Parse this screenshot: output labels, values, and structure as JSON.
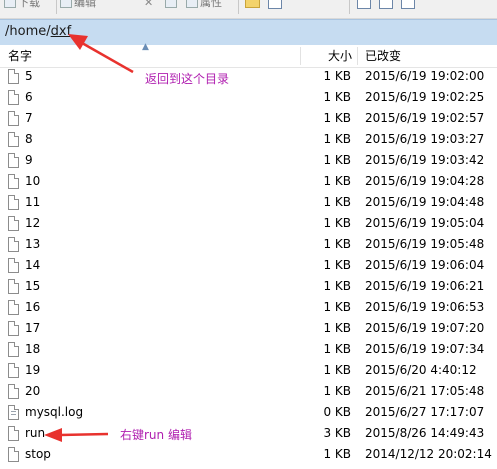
{
  "toolbar": {
    "items": [
      {
        "icon": "download-icon",
        "label": "下载"
      },
      {
        "icon": "edit-icon",
        "label": "编辑"
      },
      {
        "icon": "delete-icon",
        "label": ""
      },
      {
        "icon": "rename-icon",
        "label": ""
      },
      {
        "icon": "properties-icon",
        "label": "属性"
      },
      {
        "icon": "folder-icon",
        "label": ""
      },
      {
        "icon": "refresh-icon",
        "label": ""
      },
      {
        "icon": "upload-icon",
        "label": ""
      },
      {
        "icon": "window-icon",
        "label": ""
      },
      {
        "icon": "window-icon",
        "label": ""
      }
    ]
  },
  "path": {
    "prefix": "/home/",
    "current": "dxf"
  },
  "columns": {
    "name": "名字",
    "size": "大小",
    "modified": "已改变"
  },
  "files": [
    {
      "name": "5",
      "size": "1 KB",
      "modified": "2015/6/19 19:02:00",
      "icon": "file-icon"
    },
    {
      "name": "6",
      "size": "1 KB",
      "modified": "2015/6/19 19:02:25",
      "icon": "file-icon"
    },
    {
      "name": "7",
      "size": "1 KB",
      "modified": "2015/6/19 19:02:57",
      "icon": "file-icon"
    },
    {
      "name": "8",
      "size": "1 KB",
      "modified": "2015/6/19 19:03:27",
      "icon": "file-icon"
    },
    {
      "name": "9",
      "size": "1 KB",
      "modified": "2015/6/19 19:03:42",
      "icon": "file-icon"
    },
    {
      "name": "10",
      "size": "1 KB",
      "modified": "2015/6/19 19:04:28",
      "icon": "file-icon"
    },
    {
      "name": "11",
      "size": "1 KB",
      "modified": "2015/6/19 19:04:48",
      "icon": "file-icon"
    },
    {
      "name": "12",
      "size": "1 KB",
      "modified": "2015/6/19 19:05:04",
      "icon": "file-icon"
    },
    {
      "name": "13",
      "size": "1 KB",
      "modified": "2015/6/19 19:05:48",
      "icon": "file-icon"
    },
    {
      "name": "14",
      "size": "1 KB",
      "modified": "2015/6/19 19:06:04",
      "icon": "file-icon"
    },
    {
      "name": "15",
      "size": "1 KB",
      "modified": "2015/6/19 19:06:21",
      "icon": "file-icon"
    },
    {
      "name": "16",
      "size": "1 KB",
      "modified": "2015/6/19 19:06:53",
      "icon": "file-icon"
    },
    {
      "name": "17",
      "size": "1 KB",
      "modified": "2015/6/19 19:07:20",
      "icon": "file-icon"
    },
    {
      "name": "18",
      "size": "1 KB",
      "modified": "2015/6/19 19:07:34",
      "icon": "file-icon"
    },
    {
      "name": "19",
      "size": "1 KB",
      "modified": "2015/6/20 4:40:12",
      "icon": "file-icon"
    },
    {
      "name": "20",
      "size": "1 KB",
      "modified": "2015/6/21 17:05:48",
      "icon": "file-icon"
    },
    {
      "name": "mysql.log",
      "size": "0 KB",
      "modified": "2015/6/27 17:17:07",
      "icon": "text-file-icon"
    },
    {
      "name": "run",
      "size": "3 KB",
      "modified": "2015/8/26 14:49:43",
      "icon": "file-icon"
    },
    {
      "name": "stop",
      "size": "1 KB",
      "modified": "2014/12/12 20:02:14",
      "icon": "file-icon"
    }
  ],
  "annotations": {
    "back_dir": "返回到这个目录",
    "right_click_edit": "右键run 编辑"
  },
  "colors": {
    "path_bar": "#c6dcf1",
    "annotation": "#b020b0",
    "arrow": "#e8322e"
  }
}
